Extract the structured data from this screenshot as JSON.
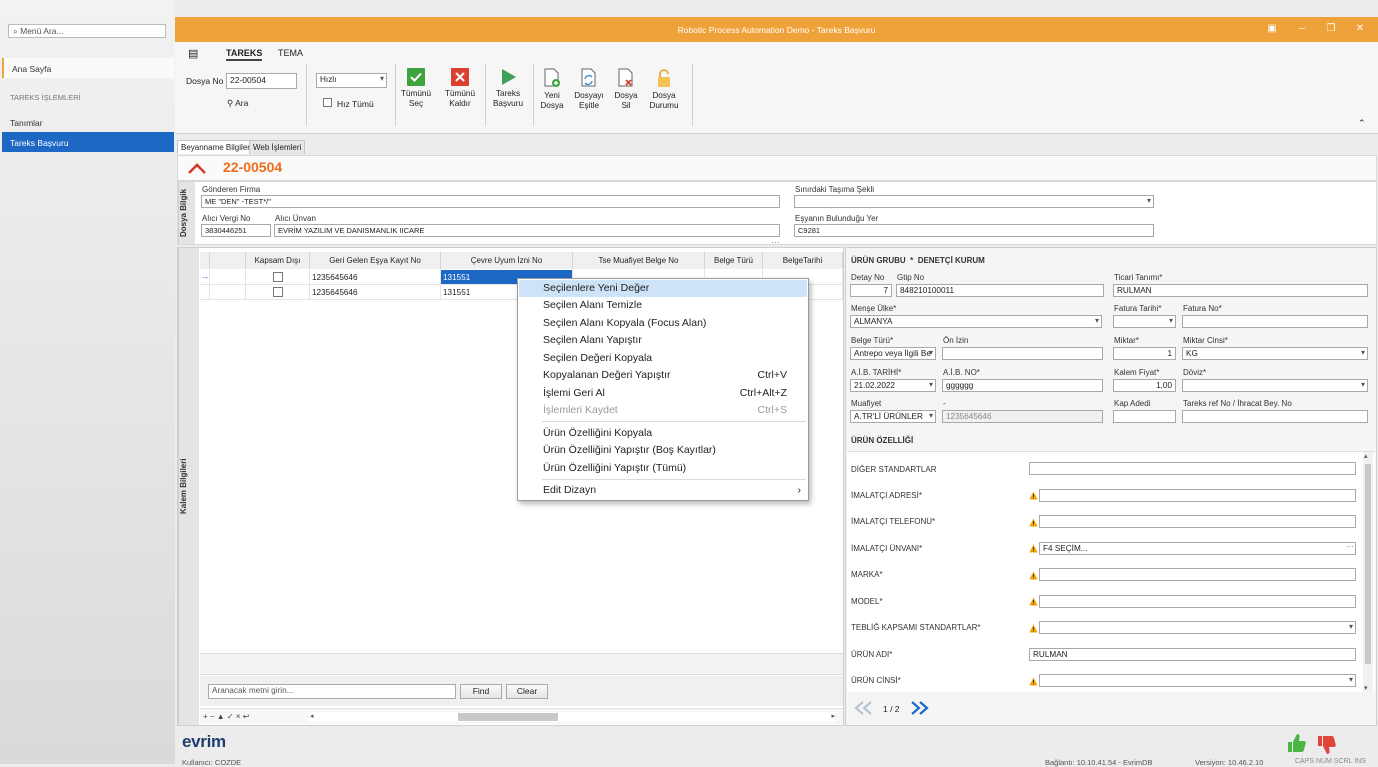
{
  "window": {
    "title": "Robotic Process Automation Demo - Tareks Başvuru"
  },
  "sidebar": {
    "search_placeholder": "Menü Ara...",
    "home": "Ana Sayfa",
    "section": "TAREKS İŞLEMLERİ",
    "items": [
      "Tanımlar",
      "Tareks Başvuru"
    ]
  },
  "ribbon": {
    "tabs": [
      "TAREKS",
      "TEMA"
    ],
    "dosya_no_label": "Dosya No",
    "dosya_no_value": "22-00504",
    "ara": "Ara",
    "hiz_value": "Hızlı",
    "hiz_tumu": "Hız Tümü",
    "buttons": [
      {
        "l1": "Tümünü",
        "l2": "Seç"
      },
      {
        "l1": "Tümünü",
        "l2": "Kaldır"
      },
      {
        "l1": "Tareks",
        "l2": "Başvuru"
      },
      {
        "l1": "Yeni",
        "l2": "Dosya"
      },
      {
        "l1": "Dosyayı",
        "l2": "Eşitle"
      },
      {
        "l1": "Dosya",
        "l2": "Sil"
      },
      {
        "l1": "Dosya",
        "l2": "Durumu"
      }
    ]
  },
  "form_tabs": [
    "Beyanname Bilgileri",
    "Web İşlemleri"
  ],
  "header": {
    "dosya_no": "22-00504"
  },
  "dosya_bilgi": {
    "side_label": "Dosya Bilgik",
    "gonderen_label": "Gönderen Firma",
    "gonderen_value": "ME \"DEN\" -TEST*/\"",
    "sinirdaki_label": "Sınırdaki Taşıma Şekli",
    "alici_vergi_label": "Alıcı Vergi No",
    "alici_vergi_value": "3830446251",
    "alici_unvan_label": "Alıcı Ünvan",
    "alici_unvan_value": "EVRİM YAZILIM VE DANISMANLIK IICARE",
    "esyanin_label": "Eşyanın Bulunduğu Yer",
    "esyanin_value": "C9281"
  },
  "kalem": {
    "side_label": "Kalem Bilgileri",
    "columns": [
      "Kapsam Dışı",
      "Geri Gelen Eşya Kayıt No",
      "Çevre Uyum İzni No",
      "Tse Muafiyet Belge No",
      "Belge Türü",
      "BelgeTarihi"
    ],
    "rows": [
      {
        "indicator": "→",
        "geri": "1235645646",
        "cevre": "131551"
      },
      {
        "indicator": "",
        "geri": "1235645646",
        "cevre": "131551"
      }
    ],
    "search_placeholder": "Aranacak metni girin...",
    "find": "Find",
    "clear": "Clear",
    "nav_icons": "+ − ▲ ✓ × ↩"
  },
  "context_menu": {
    "items": [
      {
        "label": "Seçilenlere Yeni Değer",
        "shortcut": ""
      },
      {
        "label": "Seçilen Alanı Temizle",
        "shortcut": ""
      },
      {
        "label": "Seçilen Alanı Kopyala (Focus Alan)",
        "shortcut": ""
      },
      {
        "label": "Seçilen Alanı Yapıştır",
        "shortcut": ""
      },
      {
        "label": "Seçilen Değeri Kopyala",
        "shortcut": ""
      },
      {
        "label": "Kopyalanan Değeri Yapıştır",
        "shortcut": "Ctrl+V"
      },
      {
        "label": "İşlemi Geri Al",
        "shortcut": "Ctrl+Alt+Z"
      },
      {
        "label": "İşlemleri Kaydet",
        "shortcut": "Ctrl+S"
      },
      {
        "label": "Ürün Özelliğini Kopyala",
        "shortcut": ""
      },
      {
        "label": "Ürün Özelliğini Yapıştır (Boş Kayıtlar)",
        "shortcut": ""
      },
      {
        "label": "Ürün Özelliğini Yapıştır (Tümü)",
        "shortcut": ""
      },
      {
        "label": "Edit Dizayn",
        "shortcut": "›"
      }
    ]
  },
  "urun": {
    "title": "ÜRÜN GRUBU",
    "denetci": "DENETÇİ KURUM",
    "detay_no_label": "Detay No",
    "detay_no": "7",
    "gtip_label": "Gtip No",
    "gtip": "848210100011",
    "ticari_label": "Ticari Tanımı*",
    "ticari": "RULMAN",
    "mense_label": "Menşe Ülke*",
    "mense": "ALMANYA",
    "fatura_tarihi_label": "Fatura Tarihi*",
    "fatura_no_label": "Fatura No*",
    "belge_turu_label": "Belge Türü*",
    "belge_turu": "Antrepo veya İlgili Be",
    "on_izin_label": "Ön İzin",
    "miktar_label": "Miktar*",
    "miktar": "1",
    "miktar_cinsi_label": "Miktar Cinsi*",
    "miktar_cinsi": "KG",
    "aib_tarihi_label": "A.İ.B. TARİHİ*",
    "aib_tarihi": "21.02.2022",
    "aib_no_label": "A.İ.B. NO*",
    "aib_no": "gggggg",
    "kalem_fiyat_label": "Kalem Fiyat*",
    "kalem_fiyat": "1,00",
    "doviz_label": "Döviz*",
    "muafiyet_label": "Muafiyet",
    "muafiyet": "A.TR'Lİ ÜRÜNLER",
    "dash": "-",
    "muafiyet_no": "1235645646",
    "kap_adedi_label": "Kap Adedi",
    "tareks_ref_label": "Tareks ref No / İhracat Bey. No",
    "ozellik_title": "ÜRÜN ÖZELLİĞİ",
    "ozellikler": [
      {
        "label": "DİĞER STANDARTLAR",
        "value": ""
      },
      {
        "label": "İMALATÇI ADRESİ*",
        "value": ""
      },
      {
        "label": "İMALATÇI TELEFONU*",
        "value": ""
      },
      {
        "label": "İMALATÇI ÜNVANI*",
        "value": "F4 SEÇİM..."
      },
      {
        "label": "MARKA*",
        "value": ""
      },
      {
        "label": "MODEL*",
        "value": ""
      },
      {
        "label": "TEBLİĞ KAPSAMI STANDARTLAR*",
        "value": ""
      },
      {
        "label": "ÜRÜN ADI*",
        "value": "RULMAN"
      },
      {
        "label": "ÜRÜN CİNSİ*",
        "value": ""
      }
    ],
    "pager": "1 / 2"
  },
  "status": {
    "logo": "evrim",
    "user": "Kullanıcı: COZDE",
    "connection": "Bağlantı: 10.10.41.54 - EvrimDB",
    "version": "Versiyon: 10.46.2.10",
    "keys": "CAPS  NUM  SCRL  INS"
  },
  "colors": {
    "accent": "#f0a23a",
    "selection": "#1d68c5",
    "dosya_no": "#ef6c1b",
    "warning": "#f0a800"
  }
}
